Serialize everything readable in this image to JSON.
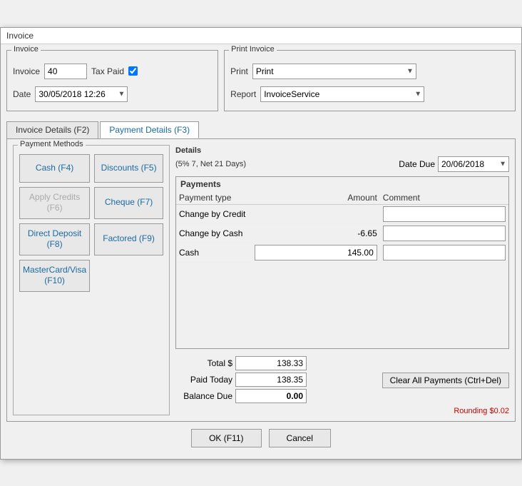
{
  "window": {
    "title": "Invoice"
  },
  "invoice_group": {
    "label": "Invoice",
    "invoice_label": "Invoice",
    "invoice_value": "40",
    "tax_paid_label": "Tax Paid",
    "tax_paid_checked": true,
    "date_label": "Date",
    "date_value": "30/05/2018 12:26"
  },
  "print_group": {
    "label": "Print Invoice",
    "print_label": "Print",
    "print_options": [
      "Print"
    ],
    "print_selected": "Print",
    "report_label": "Report",
    "report_options": [
      "InvoiceService"
    ],
    "report_selected": "InvoiceService"
  },
  "tabs": [
    {
      "id": "invoice-details",
      "label": "Invoice Details (F2)",
      "active": false
    },
    {
      "id": "payment-details",
      "label": "Payment Details (F3)",
      "active": true
    }
  ],
  "payment_methods": {
    "label": "Payment Methods",
    "buttons": [
      {
        "id": "cash",
        "label": "Cash (F4)",
        "enabled": true
      },
      {
        "id": "discounts",
        "label": "Discounts (F5)",
        "enabled": true
      },
      {
        "id": "apply-credits",
        "label": "Apply Credits (F6)",
        "enabled": false
      },
      {
        "id": "cheque",
        "label": "Cheque (F7)",
        "enabled": true
      },
      {
        "id": "direct-deposit",
        "label": "Direct Deposit (F8)",
        "enabled": true
      },
      {
        "id": "factored",
        "label": "Factored (F9)",
        "enabled": true
      },
      {
        "id": "mastercard-visa",
        "label": "MasterCard/Visa (F10)",
        "enabled": true
      }
    ]
  },
  "details": {
    "label": "Details",
    "subtitle": "(5% 7, Net 21 Days)",
    "date_due_label": "Date Due",
    "date_due_value": "20/06/2018"
  },
  "payments": {
    "label": "Payments",
    "columns": [
      "Payment type",
      "Amount",
      "Comment"
    ],
    "rows": [
      {
        "type": "Change by Credit",
        "amount": "",
        "comment": ""
      },
      {
        "type": "Change by Cash",
        "amount": "-6.65",
        "comment": ""
      },
      {
        "type": "Cash",
        "amount": "145.00",
        "comment": ""
      }
    ]
  },
  "totals": {
    "total_label": "Total $",
    "total_value": "138.33",
    "paid_today_label": "Paid Today",
    "paid_today_value": "138.35",
    "balance_due_label": "Balance Due",
    "balance_due_value": "0.00",
    "clear_btn_label": "Clear All Payments (Ctrl+Del)",
    "rounding_label": "Rounding $0.02"
  },
  "buttons": {
    "ok_label": "OK (F11)",
    "cancel_label": "Cancel"
  }
}
